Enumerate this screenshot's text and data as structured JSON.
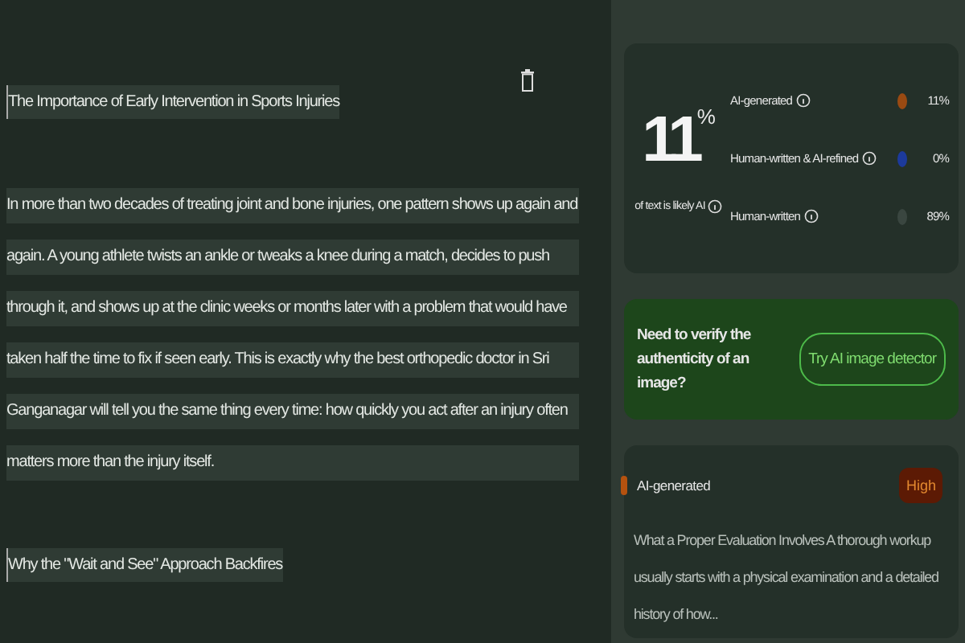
{
  "editor": {
    "blocks": [
      {
        "kind": "heading",
        "text": "The Importance of Early Intervention in Sports Injuries"
      },
      {
        "kind": "paragraph",
        "text": "In more than two decades of treating joint and bone injuries, one pattern shows up again and again. A young athlete twists an ankle or tweaks a knee during a match, decides to push through it, and shows up at the clinic weeks or months later with a problem that would have taken half the time to fix if seen early. This is exactly why the best orthopedic doctor in Sri Ganganagar will tell you the same thing every time: how quickly you act after an injury often matters more than the injury itself."
      },
      {
        "kind": "heading",
        "text": "Why the \"Wait and See\" Approach Backfires"
      }
    ]
  },
  "summary": {
    "score": "11",
    "unit": "%",
    "caption": "of text is likely AI",
    "legend": [
      {
        "label": "AI-generated",
        "value": "11%",
        "color": "#9a4a12"
      },
      {
        "label": "Human-written & AI-refined",
        "value": "0%",
        "color": "#1c3a9c"
      },
      {
        "label": "Human-written",
        "value": "89%",
        "color": "#3a4640"
      }
    ]
  },
  "promo": {
    "text": "Need to verify the authenticity of an image?",
    "button": "Try AI image detector"
  },
  "finding": {
    "label": "AI-generated",
    "color": "#b5520f",
    "badge": "High",
    "excerpt": "What a Proper Evaluation Involves A thorough workup usually starts with a physical examination and a detailed history of how..."
  }
}
